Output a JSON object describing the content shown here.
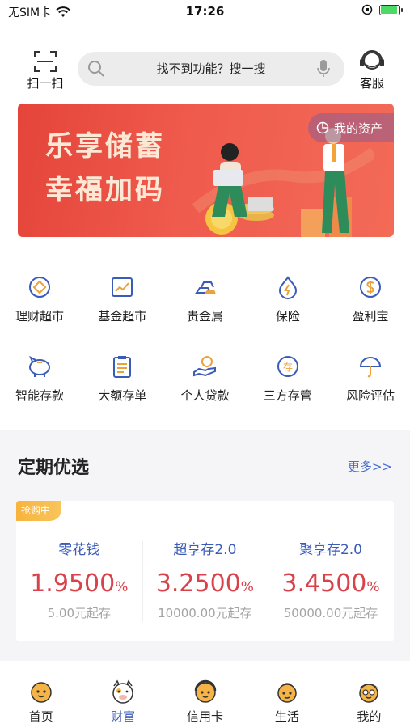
{
  "status_bar": {
    "carrier": "无SIM卡",
    "time": "17:26",
    "battery_level": 0.9
  },
  "header": {
    "scan_label": "扫一扫",
    "search_placeholder": "找不到功能？搜一搜",
    "service_label": "客服"
  },
  "banner": {
    "line1": "乐享储蓄",
    "line2": "幸福加码",
    "asset_button": "我的资产"
  },
  "grid": {
    "row1": [
      {
        "label": "理财超市",
        "icon": "wealth-market-icon"
      },
      {
        "label": "基金超市",
        "icon": "fund-chart-icon"
      },
      {
        "label": "贵金属",
        "icon": "gold-bars-icon"
      },
      {
        "label": "保险",
        "icon": "insurance-icon"
      },
      {
        "label": "盈利宝",
        "icon": "dollar-coin-icon"
      }
    ],
    "row2": [
      {
        "label": "智能存款",
        "icon": "piggy-bank-icon"
      },
      {
        "label": "大额存单",
        "icon": "clipboard-icon"
      },
      {
        "label": "个人贷款",
        "icon": "hand-coin-icon"
      },
      {
        "label": "三方存管",
        "icon": "deposit-icon"
      },
      {
        "label": "风险评估",
        "icon": "umbrella-icon"
      }
    ]
  },
  "section": {
    "title": "定期优选",
    "more": "更多>>",
    "badge": "抢购中",
    "products": [
      {
        "name": "零花钱",
        "rate": "1.9500",
        "unit": "%",
        "min": "5.00元起存"
      },
      {
        "name": "超享存2.0",
        "rate": "3.2500",
        "unit": "%",
        "min": "10000.00元起存"
      },
      {
        "name": "聚享存2.0",
        "rate": "3.4500",
        "unit": "%",
        "min": "50000.00元起存"
      }
    ]
  },
  "tabs": [
    {
      "label": "首页"
    },
    {
      "label": "财富"
    },
    {
      "label": "信用卡"
    },
    {
      "label": "生活"
    },
    {
      "label": "我的"
    }
  ],
  "colors": {
    "accent": "#3b5bb8",
    "rate": "#d9424b",
    "banner": "#ef5b4d",
    "badge": "#f7b33d"
  }
}
